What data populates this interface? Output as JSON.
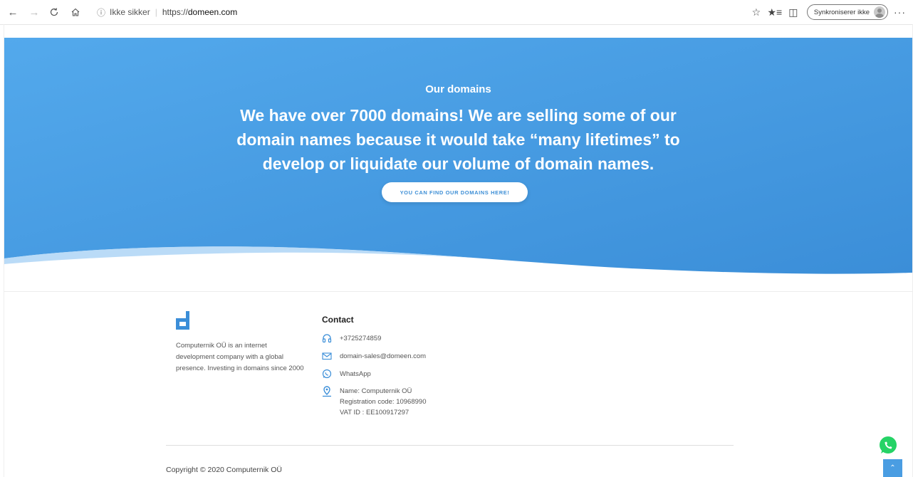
{
  "browser": {
    "info_text": "Ikke sikker",
    "url_prefix": "https://",
    "url_host": "domeen.com",
    "sync_label": "Synkroniserer ikke",
    "more_label": "···"
  },
  "hero": {
    "subtitle": "Our domains",
    "headline": "We have over 7000 domains! We are selling some of our domain names because it would take “many lifetimes” to develop or liquidate our volume of domain names.",
    "cta_label": "YOU CAN FIND OUR DOMAINS HERE!",
    "gradient_start": "#53a9ec",
    "gradient_end": "#3b8ed8"
  },
  "footer": {
    "about": "Computernik OÜ is an internet development company with a global presence. Investing in domains since 2000",
    "contact_title": "Contact",
    "phone": "+3725274859",
    "email": "domain-sales@domeen.com",
    "whatsapp": "WhatsApp",
    "address_lines": [
      "Name: Computernik OÜ",
      "Registration code: 10968990",
      "VAT ID : EE100917297"
    ],
    "copyright": "Copyright © 2020 Computernik OÜ",
    "accent": "#3b8ed8"
  },
  "icons": {
    "phone": "headset-icon",
    "email": "envelope-icon",
    "whatsapp": "whatsapp-icon",
    "location": "map-pin-icon"
  }
}
